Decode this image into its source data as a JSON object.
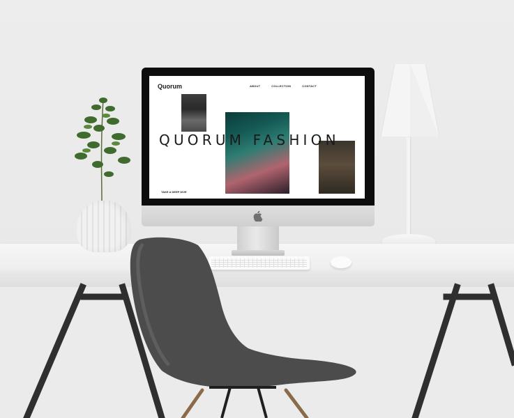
{
  "website": {
    "logo": "Quorum",
    "nav": [
      "ABOUT",
      "COLLECTION",
      "CONTACT"
    ],
    "hero_title": "QUORUM FASHION",
    "cta": "TAKE A DEEP DIVE"
  },
  "icons": {
    "monitor_logo": "apple-logo"
  },
  "colors": {
    "wall": "#ececec",
    "desk": "#f3f3f3",
    "chair": "#4a4a4a",
    "monitor_bezel": "#0d0d0d",
    "screen": "#ffffff",
    "accent_photo": "#145a55"
  }
}
